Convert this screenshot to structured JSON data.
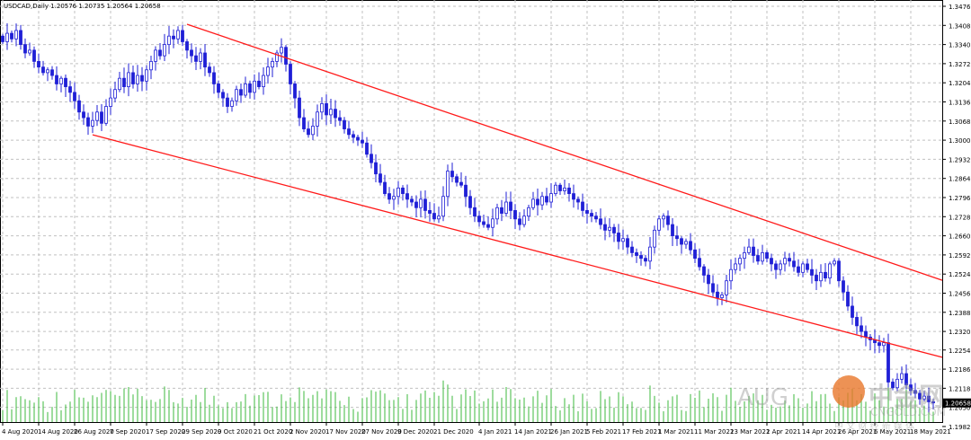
{
  "header": {
    "title": "USDCAD,Daily  1.20576 1.20735 1.20564 1.20658"
  },
  "watermark": {
    "text1": "AUG",
    "text2": "中金网",
    "text3": "CNGOLD.COM",
    "text4": "中 文 财 经 新 媒 体"
  },
  "colors": {
    "background": "#ffffff",
    "grid": "#c0c0c0",
    "candle": "#1f1fd6",
    "channel": "#ff1a1a",
    "volume": "#3cb83c",
    "frame": "#000000"
  },
  "chart_data": {
    "type": "candlestick",
    "title": "USDCAD,Daily",
    "last_price": "1.20658",
    "ylim": [
      1.1982,
      1.3476
    ],
    "y_ticks": [
      "1.34760",
      "1.34080",
      "1.33400",
      "1.32720",
      "1.32040",
      "1.31360",
      "1.30680",
      "1.30000",
      "1.29320",
      "1.28640",
      "1.27960",
      "1.27280",
      "1.26600",
      "1.25920",
      "1.25240",
      "1.24560",
      "1.23880",
      "1.23200",
      "1.22540",
      "1.21860",
      "1.21180",
      "1.20500",
      "1.19820"
    ],
    "x_ticks": [
      {
        "i": 0,
        "label": "4 Aug 2020"
      },
      {
        "i": 8,
        "label": "14 Aug 2020"
      },
      {
        "i": 16,
        "label": "26 Aug 2020"
      },
      {
        "i": 24,
        "label": "7 Sep 2020"
      },
      {
        "i": 32,
        "label": "17 Sep 2020"
      },
      {
        "i": 40,
        "label": "29 Sep 2020"
      },
      {
        "i": 48,
        "label": "9 Oct 2020"
      },
      {
        "i": 56,
        "label": "21 Oct 2020"
      },
      {
        "i": 64,
        "label": "2 Nov 2020"
      },
      {
        "i": 72,
        "label": "17 Nov 2020"
      },
      {
        "i": 80,
        "label": "27 Nov 2020"
      },
      {
        "i": 88,
        "label": "9 Dec 2020"
      },
      {
        "i": 96,
        "label": "21 Dec 2020"
      },
      {
        "i": 106,
        "label": "4 Jan 2021"
      },
      {
        "i": 114,
        "label": "14 Jan 2021"
      },
      {
        "i": 122,
        "label": "26 Jan 2021"
      },
      {
        "i": 130,
        "label": "5 Feb 2021"
      },
      {
        "i": 138,
        "label": "17 Feb 2021"
      },
      {
        "i": 146,
        "label": "1 Mar 2021"
      },
      {
        "i": 154,
        "label": "11 Mar 2021"
      },
      {
        "i": 162,
        "label": "23 Mar 2021"
      },
      {
        "i": 170,
        "label": "2 Apr 2021"
      },
      {
        "i": 178,
        "label": "14 Apr 2021"
      },
      {
        "i": 186,
        "label": "26 Apr 2021"
      },
      {
        "i": 194,
        "label": "6 May 2021"
      },
      {
        "i": 202,
        "label": "18 May 2021"
      }
    ],
    "first_open": 1.337,
    "closes": [
      1.335,
      1.338,
      1.336,
      1.339,
      1.334,
      1.331,
      1.332,
      1.328,
      1.326,
      1.324,
      1.325,
      1.323,
      1.32,
      1.322,
      1.319,
      1.317,
      1.314,
      1.31,
      1.308,
      1.305,
      1.307,
      1.31,
      1.306,
      1.312,
      1.315,
      1.318,
      1.322,
      1.319,
      1.324,
      1.32,
      1.323,
      1.321,
      1.325,
      1.328,
      1.332,
      1.33,
      1.334,
      1.337,
      1.336,
      1.339,
      1.335,
      1.332,
      1.33,
      1.328,
      1.331,
      1.326,
      1.324,
      1.32,
      1.317,
      1.315,
      1.312,
      1.314,
      1.318,
      1.316,
      1.32,
      1.317,
      1.321,
      1.319,
      1.323,
      1.326,
      1.328,
      1.331,
      1.333,
      1.327,
      1.32,
      1.315,
      1.308,
      1.304,
      1.302,
      1.305,
      1.31,
      1.313,
      1.309,
      1.311,
      1.308,
      1.307,
      1.304,
      1.302,
      1.301,
      1.3,
      1.299,
      1.295,
      1.292,
      1.288,
      1.285,
      1.281,
      1.279,
      1.28,
      1.283,
      1.281,
      1.279,
      1.278,
      1.276,
      1.279,
      1.275,
      1.274,
      1.272,
      1.273,
      1.28,
      1.289,
      1.287,
      1.285,
      1.284,
      1.28,
      1.276,
      1.273,
      1.271,
      1.27,
      1.269,
      1.272,
      1.276,
      1.274,
      1.278,
      1.275,
      1.272,
      1.27,
      1.273,
      1.276,
      1.279,
      1.277,
      1.28,
      1.278,
      1.281,
      1.284,
      1.282,
      1.283,
      1.281,
      1.279,
      1.278,
      1.275,
      1.274,
      1.273,
      1.272,
      1.27,
      1.268,
      1.269,
      1.267,
      1.264,
      1.265,
      1.262,
      1.26,
      1.259,
      1.258,
      1.257,
      1.262,
      1.268,
      1.272,
      1.273,
      1.27,
      1.266,
      1.265,
      1.263,
      1.264,
      1.261,
      1.258,
      1.255,
      1.252,
      1.249,
      1.246,
      1.244,
      1.245,
      1.25,
      1.254,
      1.256,
      1.258,
      1.26,
      1.262,
      1.259,
      1.257,
      1.26,
      1.258,
      1.256,
      1.254,
      1.256,
      1.258,
      1.257,
      1.255,
      1.253,
      1.256,
      1.254,
      1.252,
      1.25,
      1.253,
      1.251,
      1.256,
      1.257,
      1.25,
      1.246,
      1.241,
      1.237,
      1.234,
      1.232,
      1.23,
      1.229,
      1.228,
      1.227,
      1.228,
      1.214,
      1.212,
      1.215,
      1.217,
      1.213,
      1.211,
      1.21,
      1.208,
      1.209,
      1.207,
      1.2066
    ],
    "trendlines": [
      {
        "name": "upper-channel",
        "from": {
          "i": 41,
          "price": 1.3412
        },
        "to": {
          "i": 209,
          "price": 1.2502
        }
      },
      {
        "name": "lower-channel",
        "from": {
          "i": 20,
          "price": 1.3019
        },
        "to": {
          "i": 209,
          "price": 1.2228
        }
      }
    ],
    "grid": true
  }
}
